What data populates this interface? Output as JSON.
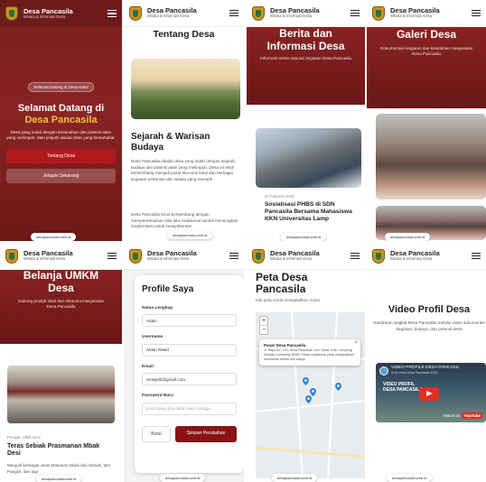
{
  "brand": {
    "name": "Desa Pancasila",
    "tagline_a": "Wisata & Informasi Desa",
    "tagline_b": "Wisata & Informasi Desa"
  },
  "colors": {
    "primary": "#7a1d1d",
    "accent": "#f3c13a",
    "button": "#b3191f"
  },
  "icons": {
    "menu": "hamburger-icon",
    "logo": "village-crest-icon",
    "pin": "map-pin-icon",
    "play": "youtube-play-icon"
  },
  "home": {
    "badge": "Selamat Datang di Desa Kami",
    "title_line1": "Selamat Datang di",
    "title_line2": "Desa Pancasila",
    "subtitle": "Desa yang indah dengan keramahan dan potensi alam yang melimpah. Mari jelajahi wisata desa yang bersahabat.",
    "btn_primary": "Tentang Desa",
    "btn_secondary": "Jelajahi Sekarang",
    "float": "desapancasila.web.id"
  },
  "about": {
    "heading": "Tentang Desa",
    "history_title": "Sejarah & Warisan Budaya",
    "para1": "Desa Pancasila adalah desa yang indah dengan sejarah, budaya dan potensi alam yang melimpah. Desa ini telah berkembang menjadi pusat ekonomi lokal dan berbagai kegiatan pertanian dan wisata yang menarik.",
    "para2": "Desa Pancasila terus berkembang dengan mempertahankan nilai-nilai tradisional sambil menerapkan modernisasi untuk kesejahteraan",
    "float": "desapancasila.web.id"
  },
  "news": {
    "heading_line1": "Berita dan",
    "heading_line2": "Informasi Desa",
    "subtitle": "Informasi terkini seputar kegiatan Desa Pancasila",
    "date": "20 Februari 2025",
    "article_title": "Sosialisasi PHBS di SDN Pancasila Bersama Mahasiswa KKN Universitas Lamp",
    "float": "desapancasila.web.id"
  },
  "gallery": {
    "heading": "Galeri Desa",
    "subtitle": "Dokumentasi kegiatan dan keindahan masyarakat Desa Pancasila",
    "float": "desapancasila.web.id"
  },
  "umkm": {
    "heading_line1": "Belanja UMKM",
    "heading_line2": "Desa",
    "subtitle": "Dukung produk lokal dan ekonomi masyarakat Desa Pancasila",
    "category": "Penjual: Ulfah Desi",
    "product_title": "Teras Sebiak Prasmanan Mbak Desi",
    "product_desc": "Menjual berbagai Jenis Makanan Mulai dari Sebiak, Mie, Pangsit, dan lagi",
    "float": "desapancasila.web.id"
  },
  "profile": {
    "title": "Profile Saya",
    "label_name": "Nama Lengkap",
    "value_name": "Aldan",
    "label_username": "Username",
    "value_username": "Aldan Rasid",
    "label_email": "Email",
    "value_email": "arosyid3@gmail.com",
    "label_password": "Password Baru",
    "placeholder_password": "Kosongkan jika tidak ingin mengga",
    "btn_cancel": "Batal",
    "btn_save": "Simpan Perubahan",
    "float": "desapancasila.web.id"
  },
  "map": {
    "title_line1": "Peta Desa",
    "title_line2": "Pancasila",
    "subtitle": "Klik peta untuk mengaktifkan zoom",
    "zoom_in": "+",
    "zoom_out": "−",
    "popup_title": "Pasar Desa Pancasila",
    "popup_body": "Jl. Raya No. 123, Desa Pancasila, Kec. Natar, Kab. Lampung Selatan, Lampung 35362. Pasar tradisional yang menyediakan kebutuhan sehari-hari warga.",
    "popup_close": "×",
    "float": "desapancasila.web.id"
  },
  "video": {
    "title": "Video Profil Desa",
    "subtitle": "Gambaran singkat Desa Pancasila melalui video dokumenter kegiatan, budaya, dan potensi desa",
    "video_title": "VIDEO PROFILE DESA PANCASIL",
    "video_channel": "KKN Unila Desa Pancasila 2025",
    "banner_line1": "VIDEO PROFIL",
    "banner_line2": "DESA PANCASILA",
    "watch_label": "Watch on",
    "watch_brand": "YouTube",
    "float": "desapancasila.web.id"
  }
}
